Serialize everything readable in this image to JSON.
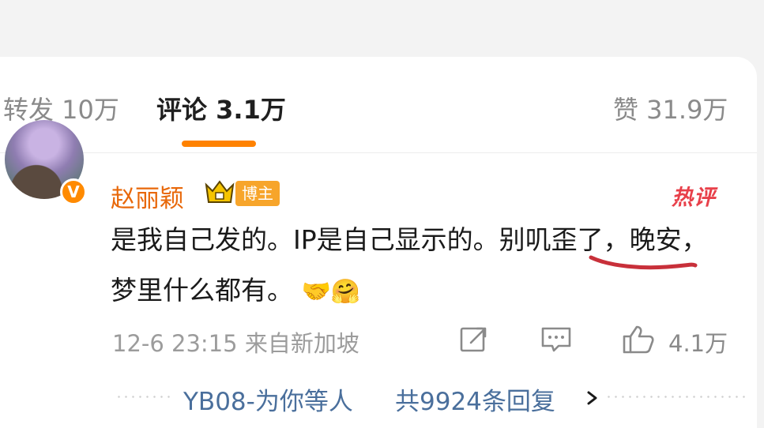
{
  "tabs": {
    "repost": "转发 10万",
    "comments": "评论 3.1万",
    "likes": "赞 31.9万"
  },
  "comment": {
    "username": "赵丽颖",
    "role_badge": "博主",
    "hot_badge": "热评",
    "verified_badge": "V",
    "text": "是我自己发的。IP是自己显示的。别叽歪了，晚安，梦里什么都有。",
    "emojis": [
      "🤝",
      "🤗"
    ],
    "time_location": "12-6 23:15 来自新加坡",
    "like_count": "4.1万",
    "icons": [
      "share-icon",
      "comment-icon",
      "thumbs-up-icon"
    ]
  },
  "replies": {
    "preview": "YB08-为你等人",
    "count": "共9924条回复"
  },
  "colors": {
    "accent": "#ff8200",
    "username": "#e8680a",
    "hot": "#e8404a",
    "link": "#4a6f9c",
    "annotation": "#c8303a"
  }
}
